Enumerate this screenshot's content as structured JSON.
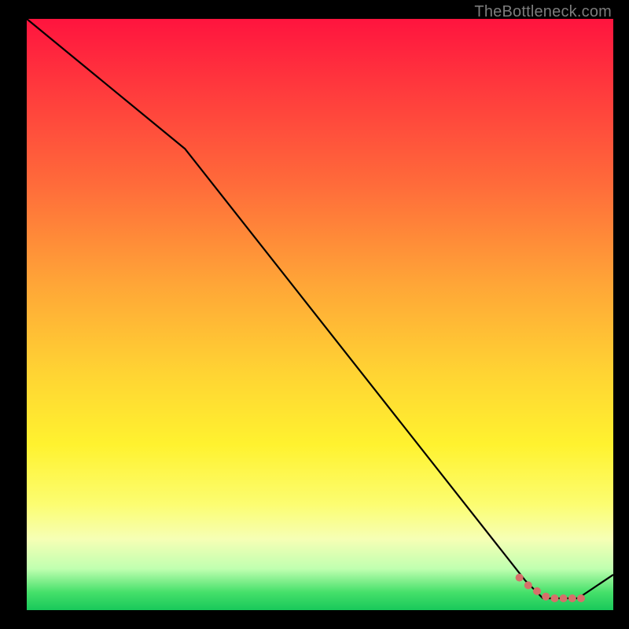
{
  "watermark": "TheBottleneck.com",
  "chart_data": {
    "type": "line",
    "title": "",
    "xlabel": "",
    "ylabel": "",
    "xlim": [
      0,
      100
    ],
    "ylim": [
      0,
      100
    ],
    "series": [
      {
        "name": "curve",
        "x": [
          0,
          27,
          85,
          88,
          94,
          100
        ],
        "y": [
          100,
          78,
          5,
          2,
          2,
          6
        ]
      }
    ],
    "markers": {
      "name": "highlight-points",
      "x": [
        84,
        85.5,
        87,
        88.5,
        90,
        91.5,
        93,
        94.5
      ],
      "y": [
        5.5,
        4.2,
        3.2,
        2.3,
        2.0,
        2.0,
        2.0,
        2.0
      ],
      "color": "#d6706a",
      "radius_px": 5
    },
    "background_gradient": {
      "orientation": "vertical",
      "stops": [
        {
          "pos": 0.0,
          "color": "#ff143e"
        },
        {
          "pos": 0.45,
          "color": "#ffa637"
        },
        {
          "pos": 0.72,
          "color": "#fff22f"
        },
        {
          "pos": 0.93,
          "color": "#c0ffb0"
        },
        {
          "pos": 1.0,
          "color": "#18c85a"
        }
      ]
    }
  }
}
